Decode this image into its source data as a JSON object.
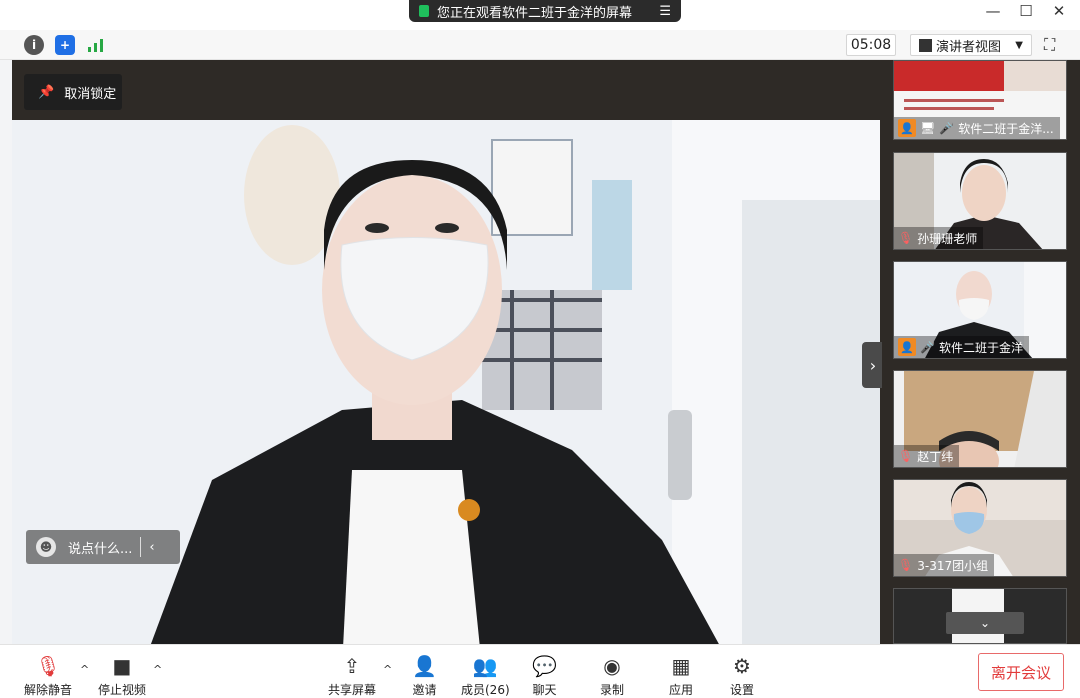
{
  "window": {
    "share_banner": "您正在观看软件二班于金洋的屏幕",
    "share_menu_icon": "menu-icon",
    "controls": [
      "—",
      "☐",
      "✕"
    ]
  },
  "topbar": {
    "timer": "05:08",
    "view_mode": "演讲者视图",
    "icons": [
      "info-icon",
      "shield-icon",
      "signal-icon",
      "fullscreen-icon"
    ]
  },
  "main": {
    "unlock_label": "取消锁定",
    "chat_placeholder": "说点什么...",
    "chat_collapse": "‹"
  },
  "sidebar": {
    "tiles": [
      {
        "name": "软件二班于金洋...",
        "host": true,
        "mic": "on",
        "sharing": true
      },
      {
        "name": "孙珊珊老师",
        "host": false,
        "mic": "muted"
      },
      {
        "name": "软件二班于金洋",
        "host": true,
        "mic": "on"
      },
      {
        "name": "赵丁纬",
        "host": false,
        "mic": "muted"
      },
      {
        "name": "3-317团小组",
        "host": false,
        "mic": "muted"
      }
    ],
    "expand_icon": "›",
    "scroll_down_icon": "⌄"
  },
  "toolbar": {
    "unmute": "解除静音",
    "stop_video": "停止视频",
    "share_screen": "共享屏幕",
    "invite": "邀请",
    "members": "成员(26)",
    "chat": "聊天",
    "record": "录制",
    "apps": "应用",
    "settings": "设置",
    "leave": "离开会议"
  },
  "colors": {
    "accent_red": "#e23b3b",
    "host_orange": "#f08a24",
    "signal_green": "#27a844",
    "shield_blue": "#1f6fe5"
  }
}
